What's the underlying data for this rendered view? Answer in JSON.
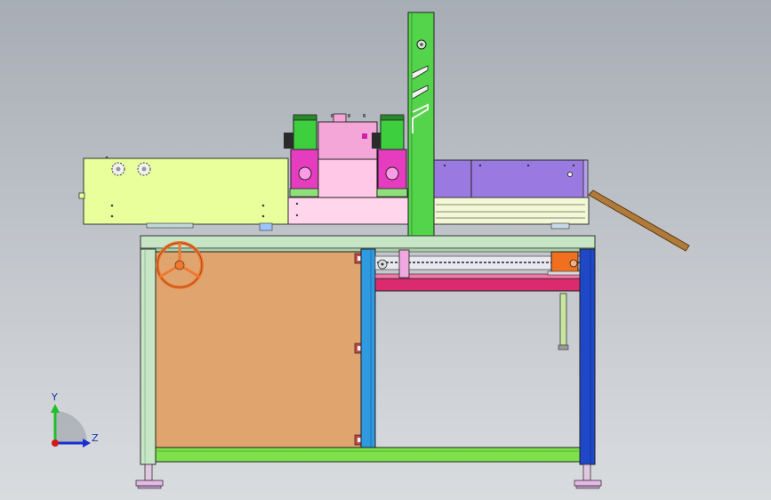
{
  "viewport": {
    "background_top": "#a7adb5",
    "background_bottom": "#d9dcdf"
  },
  "triad": {
    "y_label": "Y",
    "z_label": "Z",
    "y_color": "#1fbf2a",
    "z_color": "#1a2fd0",
    "x_color": "#d01a1a"
  },
  "colors": {
    "frame_green": "#c6e6c6",
    "frame_blue": "#2f9ae0",
    "frame_dark_blue": "#1e48c8",
    "base_bar": "#7ee04a",
    "panel_tan": "#e0a56e",
    "hand_wheel": "#f07832",
    "column_green": "#54d44a",
    "motor_green": "#3ecf3e",
    "motor_magenta": "#e63cc0",
    "pink_block": "#f5a6d8",
    "pink_box": "#ffc8e6",
    "violet_rail": "#9a7ae0",
    "lime_housing": "#e8ff9c",
    "crimson_bar": "#dc2a6e",
    "orange_cylinder": "#f07020",
    "chute_brown": "#b07a3a"
  }
}
